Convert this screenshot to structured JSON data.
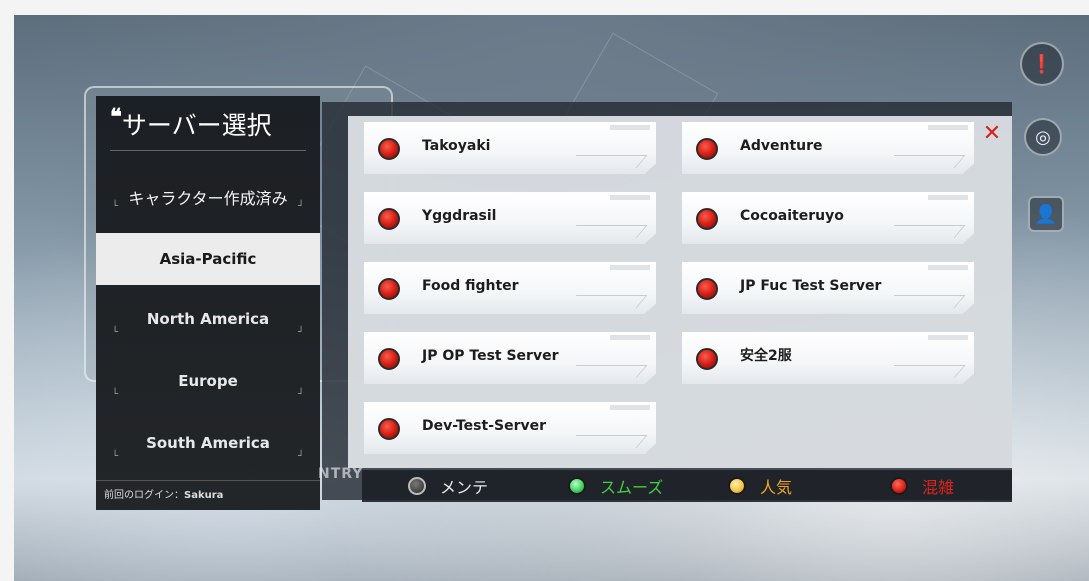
{
  "title": {
    "quote_mark": "❝",
    "text": "サーバー選択"
  },
  "sidebar": {
    "character_created": "キャラクター作成済み",
    "regions": [
      {
        "label": "Asia-Pacific",
        "active": true
      },
      {
        "label": "North America",
        "active": false
      },
      {
        "label": "Europe",
        "active": false
      },
      {
        "label": "South America",
        "active": false
      }
    ],
    "last_login_label": "前回のログイン：",
    "last_login_server": "Sakura"
  },
  "servers": [
    {
      "name": "Takoyaki",
      "status": "busy"
    },
    {
      "name": "Adventure",
      "status": "busy"
    },
    {
      "name": "Yggdrasil",
      "status": "busy"
    },
    {
      "name": "Cocoaiteruyo",
      "status": "busy"
    },
    {
      "name": "Food fighter",
      "status": "busy"
    },
    {
      "name": "JP Fuc Test Server",
      "status": "busy"
    },
    {
      "name": "JP OP Test Server",
      "status": "busy"
    },
    {
      "name": "安全2服",
      "status": "busy"
    },
    {
      "name": "Dev-Test-Server",
      "status": "busy"
    }
  ],
  "legend": [
    {
      "label": "メンテ",
      "color": "#e8e8e8",
      "dot": "#3a3a3a"
    },
    {
      "label": "スムーズ",
      "color": "#3fd03f",
      "dot": "#4dd86a"
    },
    {
      "label": "人気",
      "color": "#f0a520",
      "dot": "#f2c040"
    },
    {
      "label": "混雑",
      "color": "#e0241c",
      "dot": "#d91e16"
    }
  ],
  "background_text": "NTRY",
  "colors": {
    "panel_dark": "#1c1f23",
    "active_item": "#ececec",
    "status_busy": "#cf1b12"
  }
}
